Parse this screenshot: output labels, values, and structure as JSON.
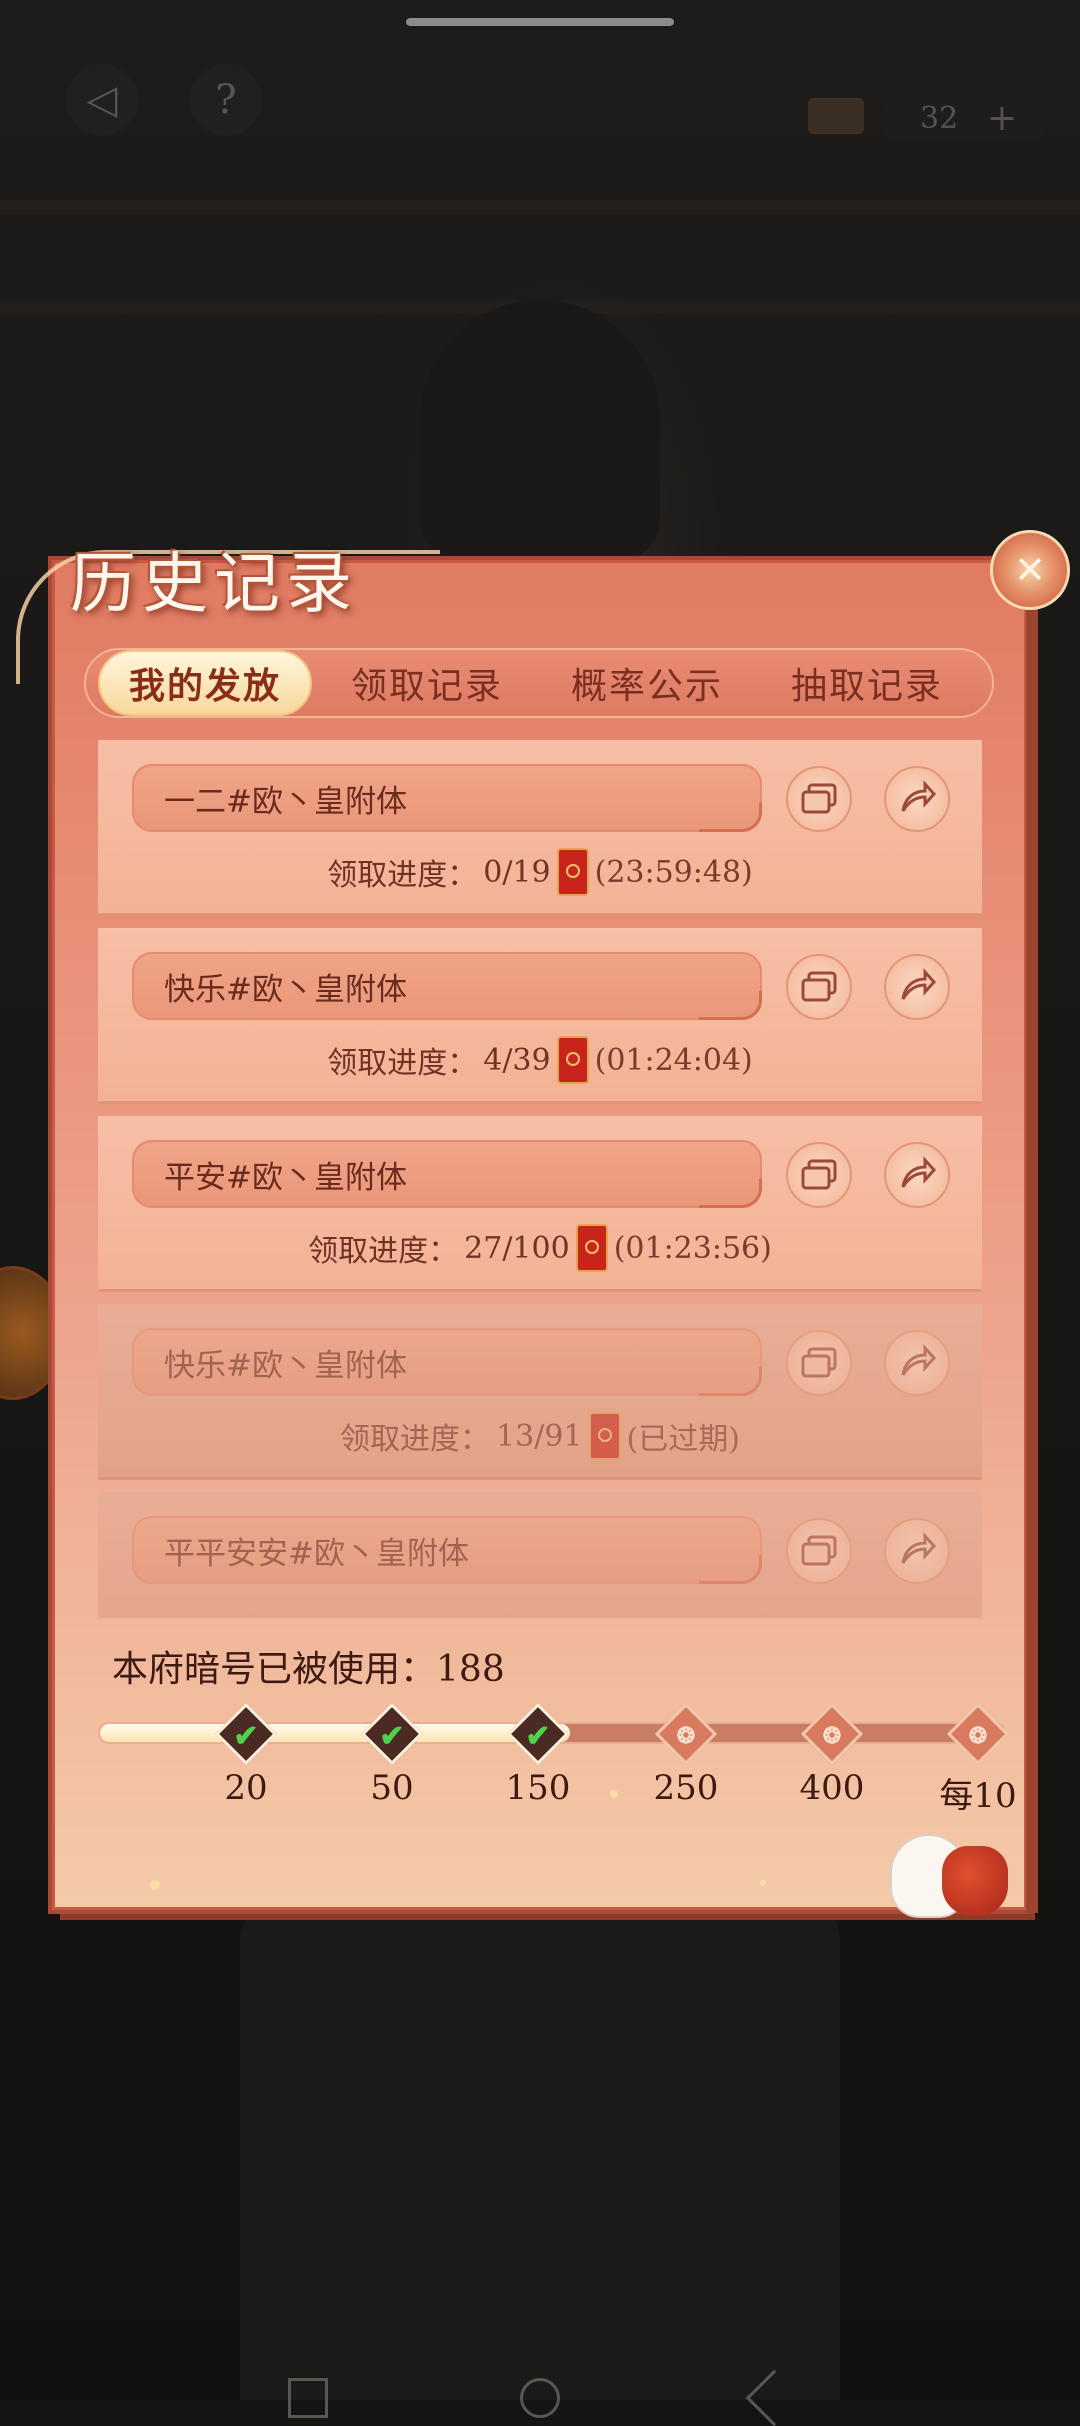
{
  "hud": {
    "back_glyph": "◁",
    "help_glyph": "?",
    "currency_count": "32",
    "plus_glyph": "+"
  },
  "panel": {
    "title": "历史记录",
    "close_glyph": "✕"
  },
  "tabs": [
    {
      "label": "我的发放",
      "active": true
    },
    {
      "label": "领取记录",
      "active": false
    },
    {
      "label": "概率公示",
      "active": false
    },
    {
      "label": "抽取记录",
      "active": false
    }
  ],
  "records": [
    {
      "name": "一二#欧丶皇附体",
      "progress_label": "领取进度：",
      "progress": "0/19",
      "time": "(23:59:48)",
      "expired": false
    },
    {
      "name": "快乐#欧丶皇附体",
      "progress_label": "领取进度：",
      "progress": "4/39",
      "time": "(01:24:04)",
      "expired": false
    },
    {
      "name": "平安#欧丶皇附体",
      "progress_label": "领取进度：",
      "progress": "27/100",
      "time": "(01:23:56)",
      "expired": false
    },
    {
      "name": "快乐#欧丶皇附体",
      "progress_label": "领取进度：",
      "progress": "13/91",
      "time": "(已过期)",
      "expired": true
    },
    {
      "name": "平平安安#欧丶皇附体",
      "progress_label": "",
      "progress": "",
      "time": "",
      "expired": true
    }
  ],
  "usage": {
    "label": "本府暗号已被使用：",
    "count": "188",
    "fill_fraction": 0.52,
    "milestones": [
      {
        "label": "20",
        "reached": true
      },
      {
        "label": "50",
        "reached": true
      },
      {
        "label": "150",
        "reached": true
      },
      {
        "label": "250",
        "reached": false
      },
      {
        "label": "400",
        "reached": false
      },
      {
        "label": "每10",
        "reached": false
      }
    ]
  },
  "colors": {
    "panel": "#e9917a",
    "active_tab": "#f8d79c",
    "check": "#4fd34a",
    "envelope": "#c8241c"
  }
}
